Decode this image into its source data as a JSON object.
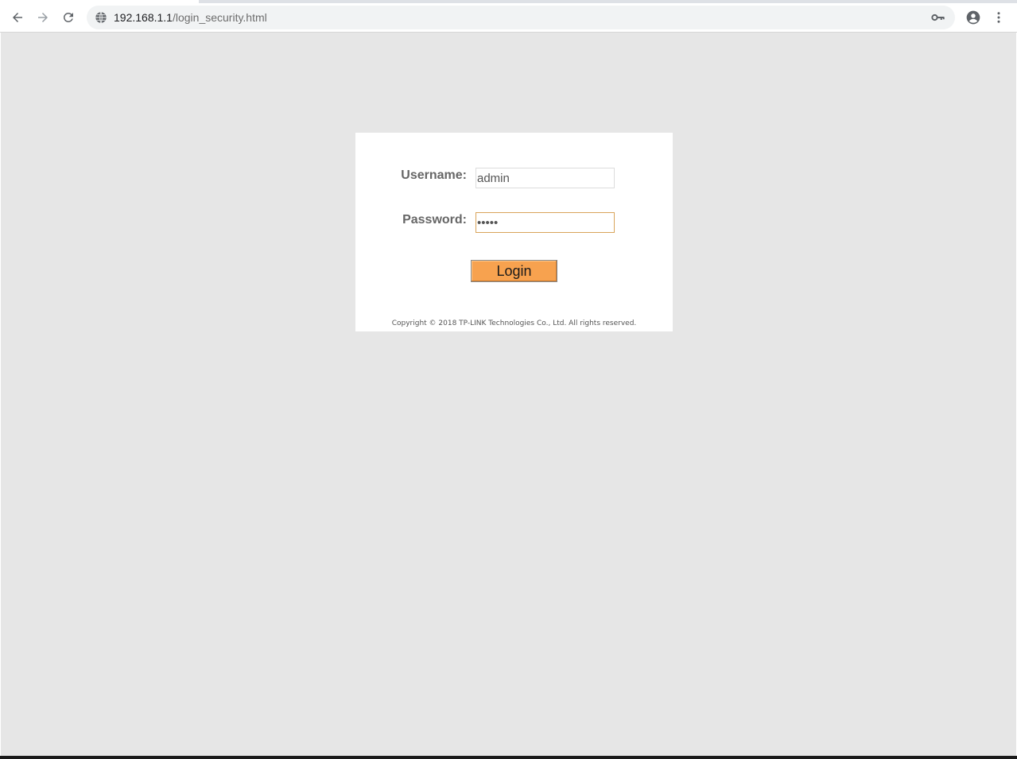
{
  "browser": {
    "url_host": "192.168.1.1",
    "url_path": "/login_security.html"
  },
  "login": {
    "username_label": "Username:",
    "username_value": "admin",
    "password_label": "Password:",
    "password_value": "•••••",
    "login_button_label": "Login",
    "copyright": "Copyright © 2018 TP-LINK Technologies Co., Ltd. All rights reserved."
  },
  "icons": {
    "back": "back-arrow-icon",
    "forward": "forward-arrow-icon",
    "reload": "reload-icon",
    "site_info": "globe-icon",
    "key": "key-icon",
    "profile": "account-circle-icon",
    "menu": "kebab-menu-icon"
  },
  "colors": {
    "page_background": "#e6e6e6",
    "panel_background": "#ffffff",
    "login_button": "#f7a24f",
    "focus_border": "#d9a45a"
  }
}
